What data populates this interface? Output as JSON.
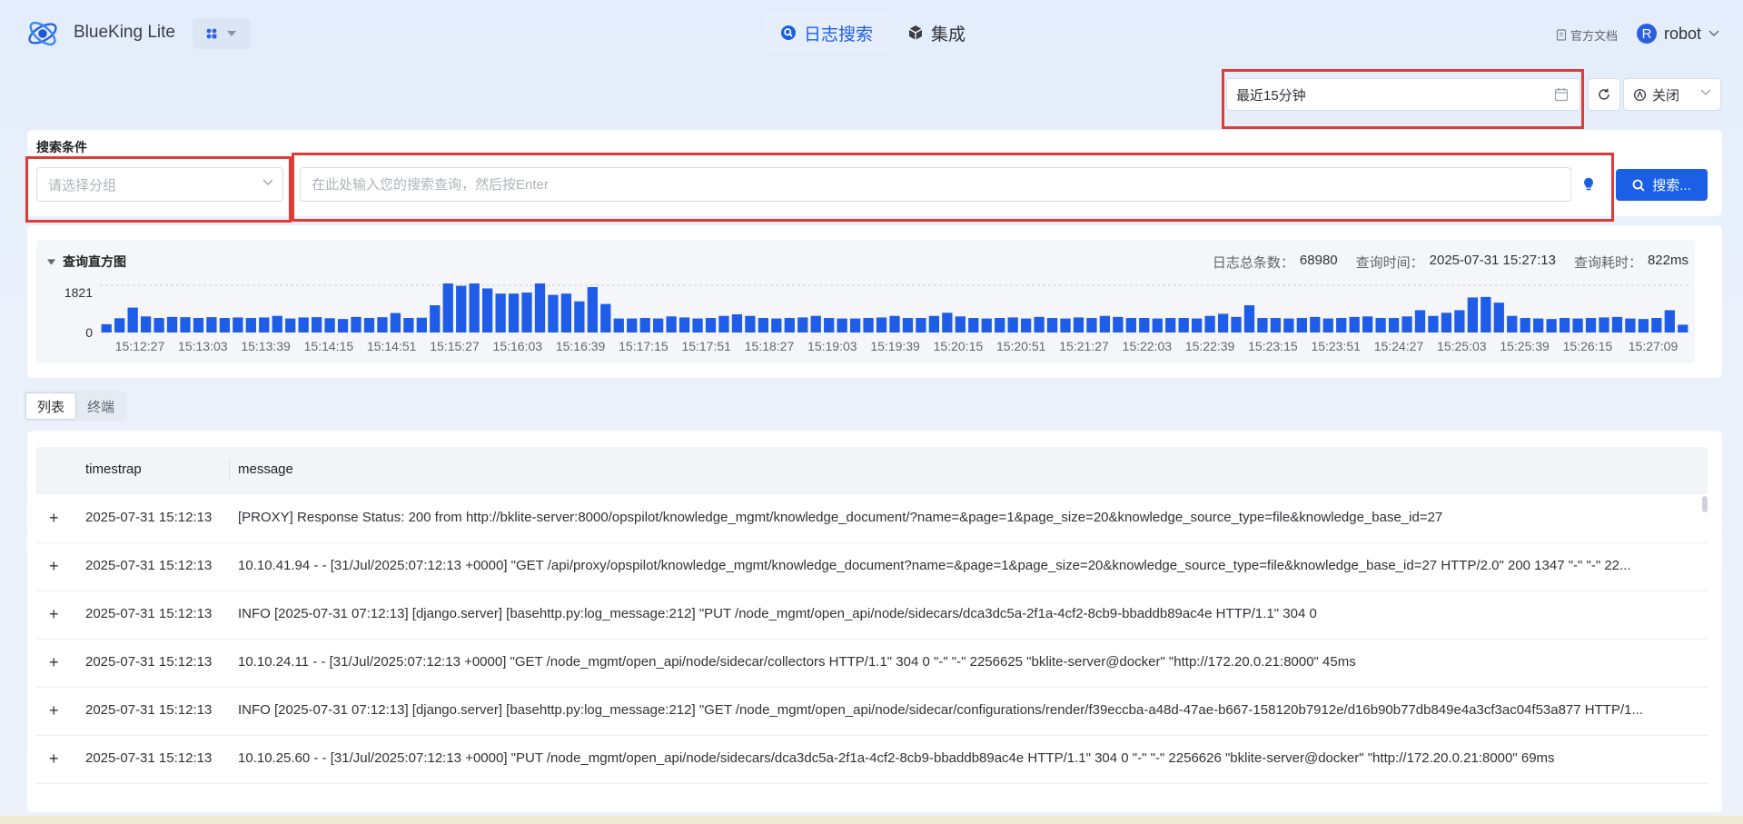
{
  "app": {
    "brand": "BlueKing Lite",
    "nav": [
      {
        "label": "日志搜索",
        "icon": "search-circle-icon",
        "active": true
      },
      {
        "label": "集成",
        "icon": "cube-icon",
        "active": false
      }
    ],
    "doc_link": "官方文档",
    "user": {
      "avatar_letter": "R",
      "name": "robot"
    }
  },
  "toolbar": {
    "time_range": "最近15分钟",
    "auto_refresh": "关闭"
  },
  "search": {
    "section_label": "搜索条件",
    "group_placeholder": "请选择分组",
    "query_placeholder": "在此处输入您的搜索查询，然后按Enter",
    "button_label": "搜索..."
  },
  "histogram": {
    "title": "查询直方图",
    "total_label": "日志总条数：",
    "total_value": "68980",
    "query_time_label": "查询时间：",
    "query_time_value": "2025-07-31 15:27:13",
    "elapsed_label": "查询耗时：",
    "elapsed_value": "822ms",
    "y_max_label": "1821",
    "y_min_label": "0"
  },
  "chart_data": {
    "type": "bar",
    "ylim": [
      0,
      1821
    ],
    "x_tick_labels": [
      "15:12:27",
      "15:13:03",
      "15:13:39",
      "15:14:15",
      "15:14:51",
      "15:15:27",
      "15:16:03",
      "15:16:39",
      "15:17:15",
      "15:17:51",
      "15:18:27",
      "15:19:03",
      "15:19:39",
      "15:20:15",
      "15:20:51",
      "15:21:27",
      "15:22:03",
      "15:22:39",
      "15:23:15",
      "15:23:51",
      "15:24:27",
      "15:25:03",
      "15:25:39",
      "15:26:15",
      "15:27:09"
    ],
    "values": [
      320,
      550,
      960,
      620,
      560,
      600,
      590,
      560,
      590,
      560,
      580,
      560,
      580,
      640,
      540,
      580,
      590,
      550,
      520,
      600,
      560,
      590,
      750,
      560,
      570,
      1050,
      1900,
      1800,
      1950,
      1700,
      1500,
      1500,
      1540,
      2000,
      1450,
      1500,
      1200,
      1750,
      1100,
      540,
      540,
      560,
      540,
      620,
      580,
      540,
      560,
      640,
      700,
      640,
      560,
      540,
      560,
      580,
      640,
      560,
      540,
      540,
      560,
      580,
      640,
      560,
      560,
      640,
      760,
      620,
      560,
      540,
      560,
      580,
      540,
      600,
      560,
      540,
      580,
      560,
      640,
      600,
      560,
      560,
      540,
      560,
      560,
      540,
      640,
      720,
      600,
      1050,
      560,
      560,
      540,
      560,
      600,
      540,
      560,
      600,
      620,
      560,
      560,
      620,
      860,
      640,
      760,
      860,
      1350,
      1370,
      1150,
      640,
      560,
      540,
      520,
      560,
      540,
      560,
      580,
      600,
      540,
      520,
      560,
      860,
      300
    ]
  },
  "tabs": [
    {
      "label": "列表",
      "active": true
    },
    {
      "label": "终端",
      "active": false
    }
  ],
  "table": {
    "columns": [
      "timestrap",
      "message"
    ],
    "rows": [
      {
        "timestamp": "2025-07-31 15:12:13",
        "message": "[PROXY] Response Status: 200 from http://bklite-server:8000/opspilot/knowledge_mgmt/knowledge_document/?name=&page=1&page_size=20&knowledge_source_type=file&knowledge_base_id=27"
      },
      {
        "timestamp": "2025-07-31 15:12:13",
        "message": "10.10.41.94 - - [31/Jul/2025:07:12:13 +0000] \"GET /api/proxy/opspilot/knowledge_mgmt/knowledge_document?name=&page=1&page_size=20&knowledge_source_type=file&knowledge_base_id=27 HTTP/2.0\" 200 1347 \"-\" \"-\" 22..."
      },
      {
        "timestamp": "2025-07-31 15:12:13",
        "message": "INFO [2025-07-31 07:12:13] [django.server] [basehttp.py:log_message:212] \"PUT /node_mgmt/open_api/node/sidecars/dca3dc5a-2f1a-4cf2-8cb9-bbaddb89ac4e HTTP/1.1\" 304 0"
      },
      {
        "timestamp": "2025-07-31 15:12:13",
        "message": "10.10.24.11 - - [31/Jul/2025:07:12:13 +0000] \"GET /node_mgmt/open_api/node/sidecar/collectors HTTP/1.1\" 304 0 \"-\" \"-\" 2256625 \"bklite-server@docker\" \"http://172.20.0.21:8000\" 45ms"
      },
      {
        "timestamp": "2025-07-31 15:12:13",
        "message": "INFO [2025-07-31 07:12:13] [django.server] [basehttp.py:log_message:212] \"GET /node_mgmt/open_api/node/sidecar/configurations/render/f39eccba-a48d-47ae-b667-158120b7912e/d16b90b77db849e4a3cf3ac04f53a877 HTTP/1..."
      },
      {
        "timestamp": "2025-07-31 15:12:13",
        "message": "10.10.25.60 - - [31/Jul/2025:07:12:13 +0000] \"PUT /node_mgmt/open_api/node/sidecars/dca3dc5a-2f1a-4cf2-8cb9-bbaddb89ac4e HTTP/1.1\" 304 0 \"-\" \"-\" 2256626 \"bklite-server@docker\" \"http://172.20.0.21:8000\" 69ms"
      }
    ],
    "expand_symbol": "+"
  },
  "colors": {
    "accent": "#1a5fe6",
    "bar": "#1f5ce8",
    "highlight_frame": "#e03b35"
  }
}
